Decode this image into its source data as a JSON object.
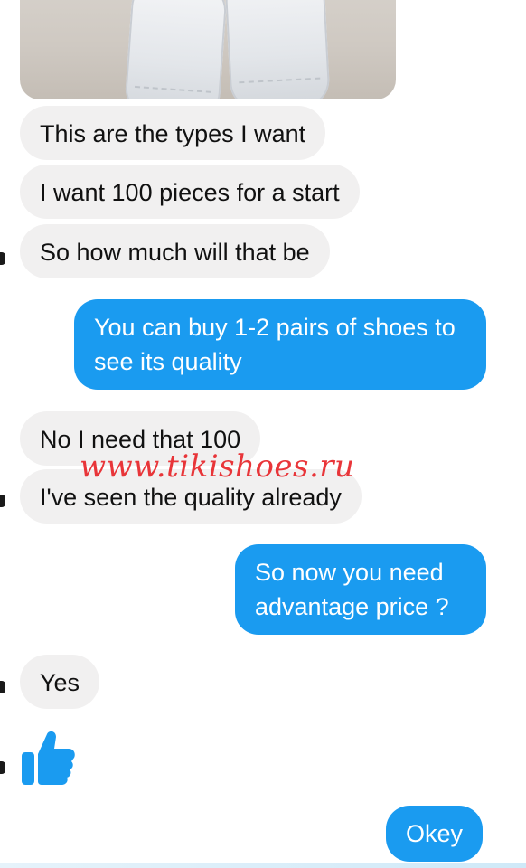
{
  "conversation": {
    "messages": [
      {
        "sender": "them",
        "text": "This are the types I want"
      },
      {
        "sender": "them",
        "text": "I want 100 pieces for a start"
      },
      {
        "sender": "them",
        "text": "So how much will that be"
      },
      {
        "sender": "me",
        "text": "You can buy 1-2 pairs of shoes to see its quality"
      },
      {
        "sender": "them",
        "text": "No I need that 100"
      },
      {
        "sender": "them",
        "text": "I've seen the quality already"
      },
      {
        "sender": "me",
        "text": "So now you need advantage price ?"
      },
      {
        "sender": "them",
        "text": "Yes"
      },
      {
        "sender": "them",
        "type": "reaction",
        "icon": "thumbs-up-icon"
      },
      {
        "sender": "me",
        "text": "Okey"
      }
    ]
  },
  "watermark": {
    "text": "www.tikishoes.ru",
    "color": "#e8262a"
  },
  "colors": {
    "outgoing_bubble": "#1a9bf0",
    "incoming_bubble": "#f1f0f0",
    "thumb_icon": "#1a9bf0"
  }
}
